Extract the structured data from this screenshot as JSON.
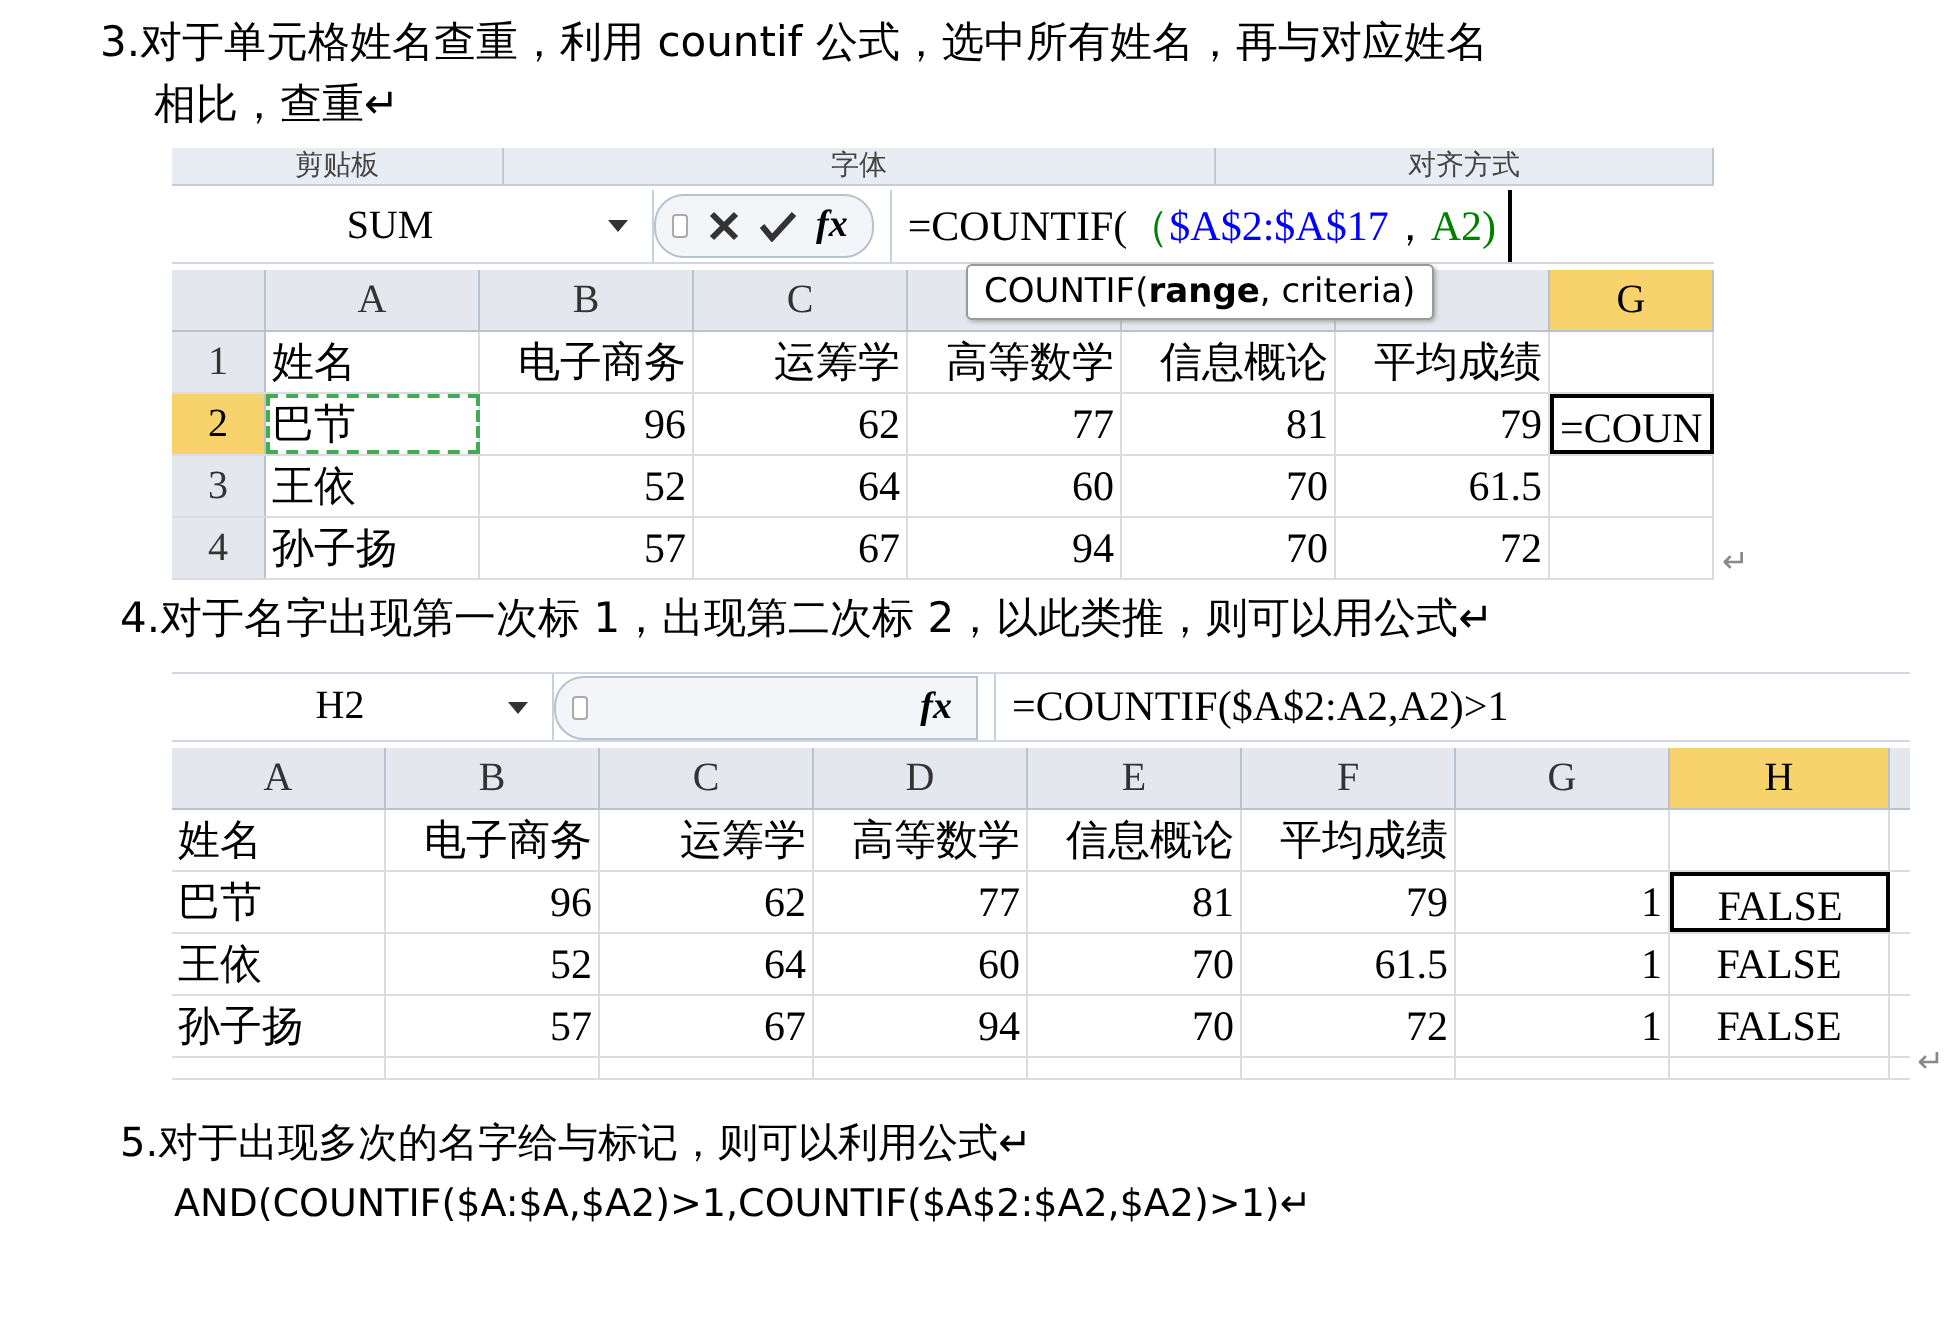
{
  "paragraphs_top": [
    {
      "lines": [
        "3.对于单元格姓名查重，利用 countif 公式，选中所有姓名，再与对应姓名",
        "相比，查重↵"
      ]
    }
  ],
  "sheet1": {
    "ribbon_groups": [
      "剪贴板",
      "字体",
      "对齐方式"
    ],
    "name_box": "SUM",
    "edit_buttons": true,
    "fx_label": "fx",
    "formula": [
      {
        "text": "=COUNTIF( ",
        "color": "#000000"
      },
      {
        "text": "（",
        "color": "#008000"
      },
      {
        "text": "$A$2:$A$17",
        "color": "#0000ff"
      },
      {
        "text": "，",
        "color": "#000000"
      },
      {
        "text": "A2)",
        "color": "#008000"
      }
    ],
    "tooltip": "COUNTIF(**range**, criteria)",
    "columns": [
      {
        "label": "A",
        "selected": false,
        "kind": "text"
      },
      {
        "label": "B",
        "selected": false,
        "kind": "number"
      },
      {
        "label": "C",
        "selected": false,
        "kind": "number"
      },
      {
        "selected": false,
        "kind": "number"
      },
      {
        "selected": false,
        "kind": "number"
      },
      {
        "selected": false,
        "kind": "number"
      },
      {
        "label": "G",
        "selected": true,
        "kind": "text"
      }
    ],
    "rows": [
      {
        "header": "1",
        "selected": false,
        "cells": [
          {
            "text": "姓名",
            "selected": false,
            "copied": false
          },
          {
            "text": "电子商务",
            "selected": false,
            "copied": false
          },
          {
            "text": "运筹学",
            "selected": false,
            "copied": false
          },
          {
            "text": "高等数学",
            "selected": false,
            "copied": false
          },
          {
            "text": "信息概论",
            "selected": false,
            "copied": false
          },
          {
            "text": "平均成绩",
            "selected": false,
            "copied": false
          },
          {
            "text": "",
            "selected": false,
            "copied": false
          }
        ]
      },
      {
        "header": "2",
        "selected": true,
        "cells": [
          {
            "text": "巴节",
            "selected": false,
            "copied": true
          },
          {
            "text": "96",
            "selected": false,
            "copied": false
          },
          {
            "text": "62",
            "selected": false,
            "copied": false
          },
          {
            "text": "77",
            "selected": false,
            "copied": false
          },
          {
            "text": "81",
            "selected": false,
            "copied": false
          },
          {
            "text": "79",
            "selected": false,
            "copied": false
          },
          {
            "text": "=COUN",
            "selected": true,
            "copied": false
          }
        ]
      },
      {
        "header": "3",
        "selected": false,
        "cells": [
          {
            "text": "王依",
            "selected": false,
            "copied": false
          },
          {
            "text": "52",
            "selected": false,
            "copied": false
          },
          {
            "text": "64",
            "selected": false,
            "copied": false
          },
          {
            "text": "60",
            "selected": false,
            "copied": false
          },
          {
            "text": "70",
            "selected": false,
            "copied": false
          },
          {
            "text": "61.5",
            "selected": false,
            "copied": false
          },
          {
            "text": "",
            "selected": false,
            "copied": false
          }
        ]
      },
      {
        "header": "4",
        "selected": false,
        "cells": [
          {
            "text": "孙子扬",
            "selected": false,
            "copied": false
          },
          {
            "text": "57",
            "selected": false,
            "copied": false
          },
          {
            "text": "67",
            "selected": false,
            "copied": false
          },
          {
            "text": "94",
            "selected": false,
            "copied": false
          },
          {
            "text": "70",
            "selected": false,
            "copied": false
          },
          {
            "text": "72",
            "selected": false,
            "copied": false
          },
          {
            "text": "",
            "selected": false,
            "copied": false
          }
        ]
      }
    ],
    "after_mark": "↵"
  },
  "paragraph_mid": "4.对于名字出现第一次标 1，出现第二次标 2，以此类推，则可以用公式↵",
  "sheet2": {
    "name_box": "H2",
    "edit_buttons": false,
    "fx_label": "fx",
    "formula": [
      {
        "text": "=COUNTIF($A$2:A2,A2)>1",
        "color": "#000000"
      }
    ],
    "columns": [
      {
        "label": "A",
        "selected": false,
        "kind": "text"
      },
      {
        "label": "B",
        "selected": false,
        "kind": "number"
      },
      {
        "label": "C",
        "selected": false,
        "kind": "number"
      },
      {
        "label": "D",
        "selected": false,
        "kind": "number"
      },
      {
        "label": "E",
        "selected": false,
        "kind": "number"
      },
      {
        "label": "F",
        "selected": false,
        "kind": "number"
      },
      {
        "label": "G",
        "selected": false,
        "kind": "number"
      },
      {
        "label": "H",
        "selected": true,
        "kind": "boolean"
      }
    ],
    "rows": [
      {
        "cells": [
          {
            "text": "姓名",
            "selected": false
          },
          {
            "text": "电子商务",
            "selected": false
          },
          {
            "text": "运筹学",
            "selected": false
          },
          {
            "text": "高等数学",
            "selected": false
          },
          {
            "text": "信息概论",
            "selected": false
          },
          {
            "text": "平均成绩",
            "selected": false
          },
          {
            "text": "",
            "selected": false
          },
          {
            "text": "",
            "selected": false
          }
        ]
      },
      {
        "cells": [
          {
            "text": "巴节",
            "selected": false
          },
          {
            "text": "96",
            "selected": false
          },
          {
            "text": "62",
            "selected": false
          },
          {
            "text": "77",
            "selected": false
          },
          {
            "text": "81",
            "selected": false
          },
          {
            "text": "79",
            "selected": false
          },
          {
            "text": "1",
            "selected": false
          },
          {
            "text": "FALSE",
            "selected": true
          }
        ]
      },
      {
        "cells": [
          {
            "text": "王依",
            "selected": false
          },
          {
            "text": "52",
            "selected": false
          },
          {
            "text": "64",
            "selected": false
          },
          {
            "text": "60",
            "selected": false
          },
          {
            "text": "70",
            "selected": false
          },
          {
            "text": "61.5",
            "selected": false
          },
          {
            "text": "1",
            "selected": false
          },
          {
            "text": "FALSE",
            "selected": false
          }
        ]
      },
      {
        "cells": [
          {
            "text": "孙子扬",
            "selected": false
          },
          {
            "text": "57",
            "selected": false
          },
          {
            "text": "67",
            "selected": false
          },
          {
            "text": "94",
            "selected": false
          },
          {
            "text": "70",
            "selected": false
          },
          {
            "text": "72",
            "selected": false
          },
          {
            "text": "1",
            "selected": false
          },
          {
            "text": "FALSE",
            "selected": false
          }
        ]
      }
    ],
    "after_mark": "↵"
  },
  "paragraph_bottom": {
    "lines": [
      "5.对于出现多次的名字给与标记，则可以利用公式↵",
      "AND(COUNTIF($A:$A,$A2)>1,COUNTIF($A$2:$A2,$A2)>1)↵"
    ]
  }
}
